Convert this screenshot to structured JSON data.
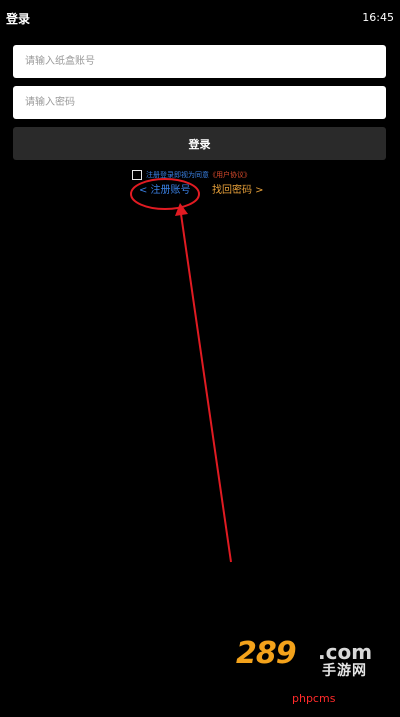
{
  "status_bar": {
    "title": "登录",
    "time": "16:45"
  },
  "login_form": {
    "account_placeholder": "请输入纸盒账号",
    "password_placeholder": "请输入密码",
    "login_button_label": "登录",
    "agreement_text": "注册登录即视为同意",
    "agreement_link": "《用户协议》",
    "register_link": "< 注册账号",
    "forgot_password_link": "找回密码 >"
  },
  "colors": {
    "background": "#000000",
    "link_blue": "#3b82e6",
    "link_orange": "#e8a13a",
    "annotation_red": "#e11b22"
  },
  "watermark": {
    "brand": "289",
    "tld": ".com",
    "subtitle": "手游网",
    "footer": "phpcms"
  }
}
